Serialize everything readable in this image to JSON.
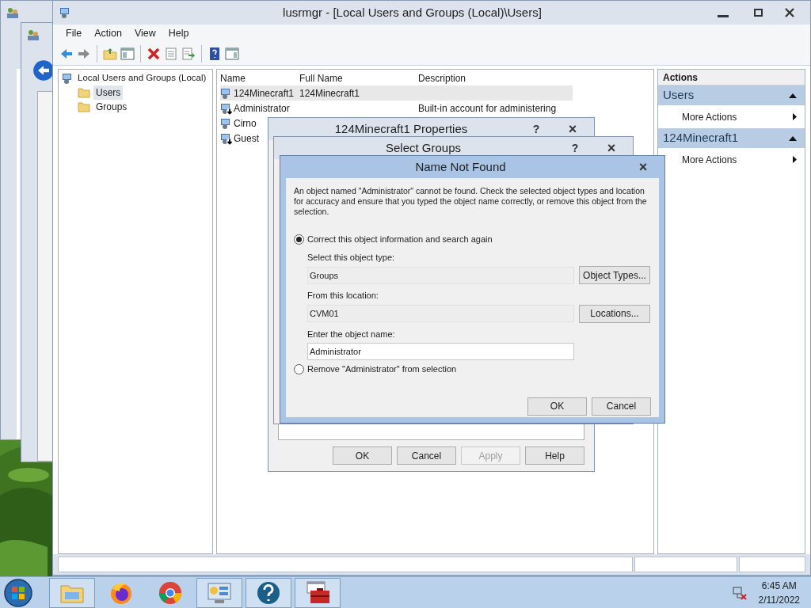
{
  "main_window": {
    "title": "lusrmgr - [Local Users and Groups (Local)\\Users]",
    "menu": [
      "File",
      "Action",
      "View",
      "Help"
    ],
    "toolbar": [
      {
        "kind": "back"
      },
      {
        "kind": "forward"
      },
      {
        "kind": "separator"
      },
      {
        "kind": "up"
      },
      {
        "kind": "tree-toggle"
      },
      {
        "kind": "separator"
      },
      {
        "kind": "delete"
      },
      {
        "kind": "properties"
      },
      {
        "kind": "export"
      },
      {
        "kind": "separator"
      },
      {
        "kind": "help"
      },
      {
        "kind": "pane-toggle"
      }
    ],
    "tree": {
      "label": "Local Users and Groups (Local)",
      "children": [
        {
          "label": "Users",
          "selected": true
        },
        {
          "label": "Groups",
          "selected": false
        }
      ]
    },
    "list": {
      "columns": [
        "Name",
        "Full Name",
        "Description"
      ],
      "rows": [
        {
          "name": "124Minecraft1",
          "full_name": "124Minecraft1",
          "description": "",
          "disabled": false,
          "selected": true
        },
        {
          "name": "Administrator",
          "full_name": "",
          "description": "Built-in account for administering",
          "disabled": true,
          "selected": false
        },
        {
          "name": "Cirno",
          "full_name": "",
          "description": "",
          "disabled": false,
          "selected": false
        },
        {
          "name": "Guest",
          "full_name": "",
          "description": "",
          "disabled": true,
          "selected": false
        }
      ]
    },
    "actions": {
      "header": "Actions",
      "sections": [
        {
          "title": "Users",
          "expanded": true,
          "items": [
            "More Actions"
          ]
        },
        {
          "title": "124Minecraft1",
          "expanded": true,
          "items": [
            "More Actions"
          ]
        }
      ]
    }
  },
  "properties_dialog": {
    "title": "124Minecraft1 Properties",
    "help": "?",
    "close": "×",
    "buttons": [
      {
        "label": "OK",
        "disabled": false
      },
      {
        "label": "Cancel",
        "disabled": false
      },
      {
        "label": "Apply",
        "disabled": true
      },
      {
        "label": "Help",
        "disabled": false
      }
    ]
  },
  "select_groups_dialog": {
    "title": "Select Groups",
    "help": "?",
    "close": "×"
  },
  "name_not_found_dialog": {
    "title": "Name Not Found",
    "close": "×",
    "message": "An object named \"Administrator\" cannot be found. Check the selected object types and location for accuracy and ensure that you typed the object name correctly, or remove this object from the selection.",
    "options": [
      {
        "label": "Correct this object information and search again",
        "selected": true
      },
      {
        "label": "Remove \"Administrator\" from selection",
        "selected": false
      }
    ],
    "fields": [
      {
        "label": "Select this object type:",
        "value": "Groups",
        "readonly": true,
        "button": "Object Types..."
      },
      {
        "label": "From this location:",
        "value": "CVM01",
        "readonly": true,
        "button": "Locations..."
      },
      {
        "label": "Enter the object name:",
        "value": "Administrator",
        "readonly": false
      }
    ],
    "buttons": [
      "OK",
      "Cancel"
    ]
  },
  "taskbar": {
    "apps": [
      {
        "kind": "folder",
        "open": true
      },
      {
        "kind": "fox",
        "open": false
      },
      {
        "kind": "chrome",
        "open": false
      },
      {
        "kind": "server",
        "open": true
      },
      {
        "kind": "help",
        "open": true
      },
      {
        "kind": "toolbox",
        "open": true
      }
    ],
    "clock": {
      "time": "6:45 AM",
      "date": "2/11/2022"
    }
  }
}
